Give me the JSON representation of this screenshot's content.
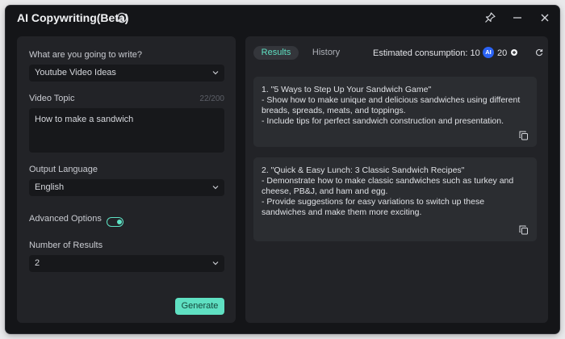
{
  "window": {
    "title": "AI Copywriting(Beta)"
  },
  "form": {
    "write_label": "What are you going to write?",
    "write_value": "Youtube Video Ideas",
    "topic_label": "Video Topic",
    "topic_counter": "22/200",
    "topic_value": "How to make a sandwich",
    "language_label": "Output Language",
    "language_value": "English",
    "advanced_label": "Advanced Options",
    "advanced_on": true,
    "results_label": "Number of Results",
    "results_value": "2",
    "generate_label": "Generate"
  },
  "results_panel": {
    "tabs": [
      "Results",
      "History"
    ],
    "consumption": "Estimated consumption: 10",
    "ai_badge": "AI",
    "credits": "20",
    "cards": [
      {
        "lines": [
          "1. \"5 Ways to Step Up Your Sandwich Game\"",
          "- Show how to make unique and delicious sandwiches using different breads, spreads, meats, and toppings.",
          "- Include tips for perfect sandwich construction and presentation."
        ]
      },
      {
        "lines": [
          "2. \"Quick & Easy Lunch: 3 Classic Sandwich Recipes\"",
          "- Demonstrate how to make classic sandwiches such as turkey and cheese, PB&J, and ham and egg.",
          "- Provide suggestions for easy variations to switch up these sandwiches and make them more exciting."
        ]
      }
    ]
  },
  "colors": {
    "accent": "#5fe0c2",
    "window_bg": "#141518",
    "panel_bg": "#222327",
    "card_bg": "#2b2d31",
    "badge_blue": "#2b63f5"
  },
  "icons": [
    "info-icon",
    "pin-icon",
    "minimize-icon",
    "close-icon",
    "chevron-down-icon",
    "plus-icon",
    "refresh-icon",
    "copy-icon"
  ]
}
